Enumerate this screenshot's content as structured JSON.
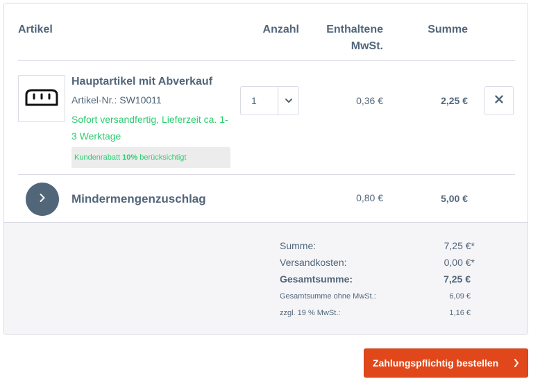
{
  "header": {
    "artikel": "Artikel",
    "anzahl": "Anzahl",
    "mwst_line1": "Enthaltene",
    "mwst_line2": "MwSt.",
    "summe": "Summe"
  },
  "item": {
    "image_icon": "bread-icon",
    "name": "Hauptartikel mit Abverkauf",
    "sku": "Artikel-Nr.: SW10011",
    "delivery": "Sofort versandfertig, Lieferzeit ca. 1-3 Werktage",
    "discount_prefix": "Kundenrabatt ",
    "discount_value": "10%",
    "discount_suffix": " berücksichtigt",
    "quantity": "1",
    "vat": "0,36 €",
    "total": "2,25 €",
    "remove_icon": "close-icon"
  },
  "surcharge": {
    "icon": "chevron-right-icon",
    "label": "Mindermengenzuschlag",
    "vat": "0,80 €",
    "total": "5,00 €"
  },
  "summary": {
    "summe_label": "Summe:",
    "summe_value": "7,25 €*",
    "versand_label": "Versandkosten:",
    "versand_value": "0,00 €*",
    "gesamt_label": "Gesamtsumme:",
    "gesamt_value": "7,25 €",
    "netto_label": "Gesamtsumme ohne MwSt.:",
    "netto_value": "6,09 €",
    "mwst_label": "zzgl. 19 % MwSt.:",
    "mwst_value": "1,16 €"
  },
  "checkout": {
    "label": "Zahlungspflichtig bestellen",
    "icon": "chevron-right-icon"
  },
  "colors": {
    "text": "#52667a",
    "border": "#dadae5",
    "success": "#2ecc71",
    "accent": "#e0481b",
    "summary_bg": "#f5f5f8"
  }
}
